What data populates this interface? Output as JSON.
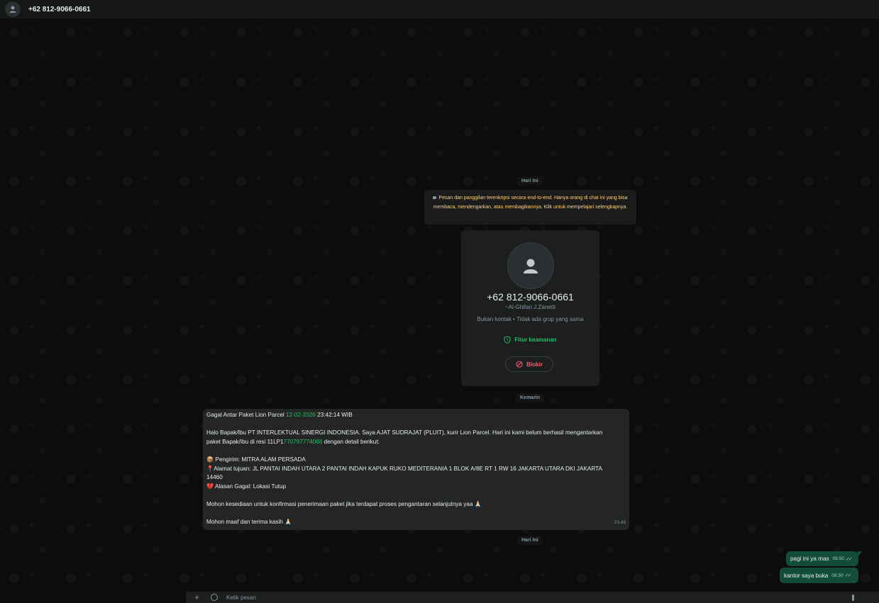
{
  "header": {
    "title": "+62 812-9066-0661",
    "avatar_icon": "person-icon"
  },
  "chat": {
    "day_today_1": "Hari Ini",
    "encryption_notice": "Pesan dan panggilan terenkripsi secara end-to-end. Hanya orang di chat ini yang bisa membaca, mendengarkan, atau membagikannya. Klik untuk mempelajari selengkapnya.",
    "profile": {
      "phone": "+62 812-9066-0661",
      "name": "~Al-Ghifari J.Zanetti",
      "subtitle": "Bukan kontak • Tidak ada grup yang sama",
      "security_label": "Fitur keamanan",
      "block_label": "Blokir"
    },
    "day_yesterday": "Kemarin",
    "incoming": {
      "title_prefix": "Gagal Antar Paket Lion Parcel ",
      "title_date": "12-02-2026",
      "title_suffix": " 23:42:14 WIB",
      "greeting_1": "Halo Bapak/Ibu PT INTERLEKTUAL SINERGI INDONESIA. Saya AJAT SUDRAJAT (PLUIT), kurir Lion Parcel. Hari ini kami belum berhasil mengantarkan",
      "greeting_2_prefix": "paket Bapak/Ibu di resi 11LP1",
      "greeting_2_resi": "770797774068",
      "greeting_2_suffix": " dengan detail berikut:",
      "sender_emoji": "📦",
      "sender": " Pengirim: MITRA ALAM PERSADA",
      "address_emoji": "📍",
      "address": "Alamat tujuan: JL PANTAI INDAH UTARA 2 PANTAI INDAH KAPUK RUKO MEDITERANIA 1 BLOK A/8E RT 1 RW 16 JAKARTA UTARA DKI JAKARTA",
      "address_zip": "14460",
      "reason_emoji": "💔",
      "reason": " Alasan Gagal: Lokasi Tutup",
      "confirm": "Mohon kesediaan untuk konfirmasi penerimaan paket jika terdapat proses pengantaran selanjutnya yaa 🙏🏻",
      "closing": "Mohon maaf dan terima kasih 🙏🏻",
      "time": "23.43"
    },
    "day_today_2": "Hari Ini",
    "outgoing": [
      {
        "text": "pagi ini ya mas",
        "time": "08.50"
      },
      {
        "text": "kantor saya buka",
        "time": "08.50"
      }
    ]
  },
  "composer": {
    "placeholder": "Ketik pesan"
  },
  "colors": {
    "accent_green": "#21c063",
    "outgoing_bubble": "#144d37",
    "incoming_bubble": "#242626",
    "block_red": "#f15c6d",
    "notice_yellow": "#ffd279"
  }
}
